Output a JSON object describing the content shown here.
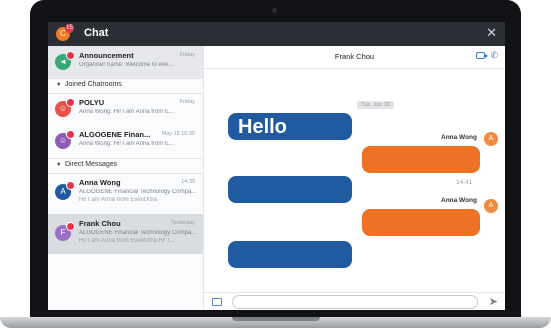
{
  "window": {
    "title": "Chat",
    "avatar_letter": "C",
    "badge_count": "15",
    "close_glyph": "✕"
  },
  "sidebar": {
    "top_item": {
      "name": "Announcement",
      "time": "Friday",
      "preview": "Organiser name: Welcome to eve..."
    },
    "sections": {
      "joined": "Joined Chatrooms",
      "direct": "Direct Messages"
    },
    "joined": [
      {
        "name": "POLYU",
        "time": "Friday",
        "preview": "Anna Wong: Hi! I am Anna from E..."
      },
      {
        "name": "ALGOGENE Finan...",
        "time": "May 18 10:30",
        "preview": "Anna Wong: Hi! I am Anna from E..."
      }
    ],
    "direct": [
      {
        "letter": "A",
        "name": "Anna Wong",
        "time": "14:39",
        "line1": "ALGOGENE Financial Technology Compa...",
        "line2": "Hi! I am Anna from EventXtra."
      },
      {
        "letter": "F",
        "name": "Frank Chou",
        "time": "Yesterday",
        "line1": "ALGOGENE Financial Technology Compa...",
        "line2": "Hi! I am Anna from EventXtra.Hi! I..."
      }
    ]
  },
  "chat": {
    "contact": "Frank Chou",
    "date_chip": "Tue, Jun 18",
    "hello": "Hello",
    "sender_name": "Anna Wong",
    "sender_letter": "A",
    "timestamp": "14:41",
    "input_placeholder": ""
  },
  "colors": {
    "blue_bubble": "#1f5b9e",
    "orange_bubble": "#ef7224",
    "accent": "#3b7fd8"
  }
}
